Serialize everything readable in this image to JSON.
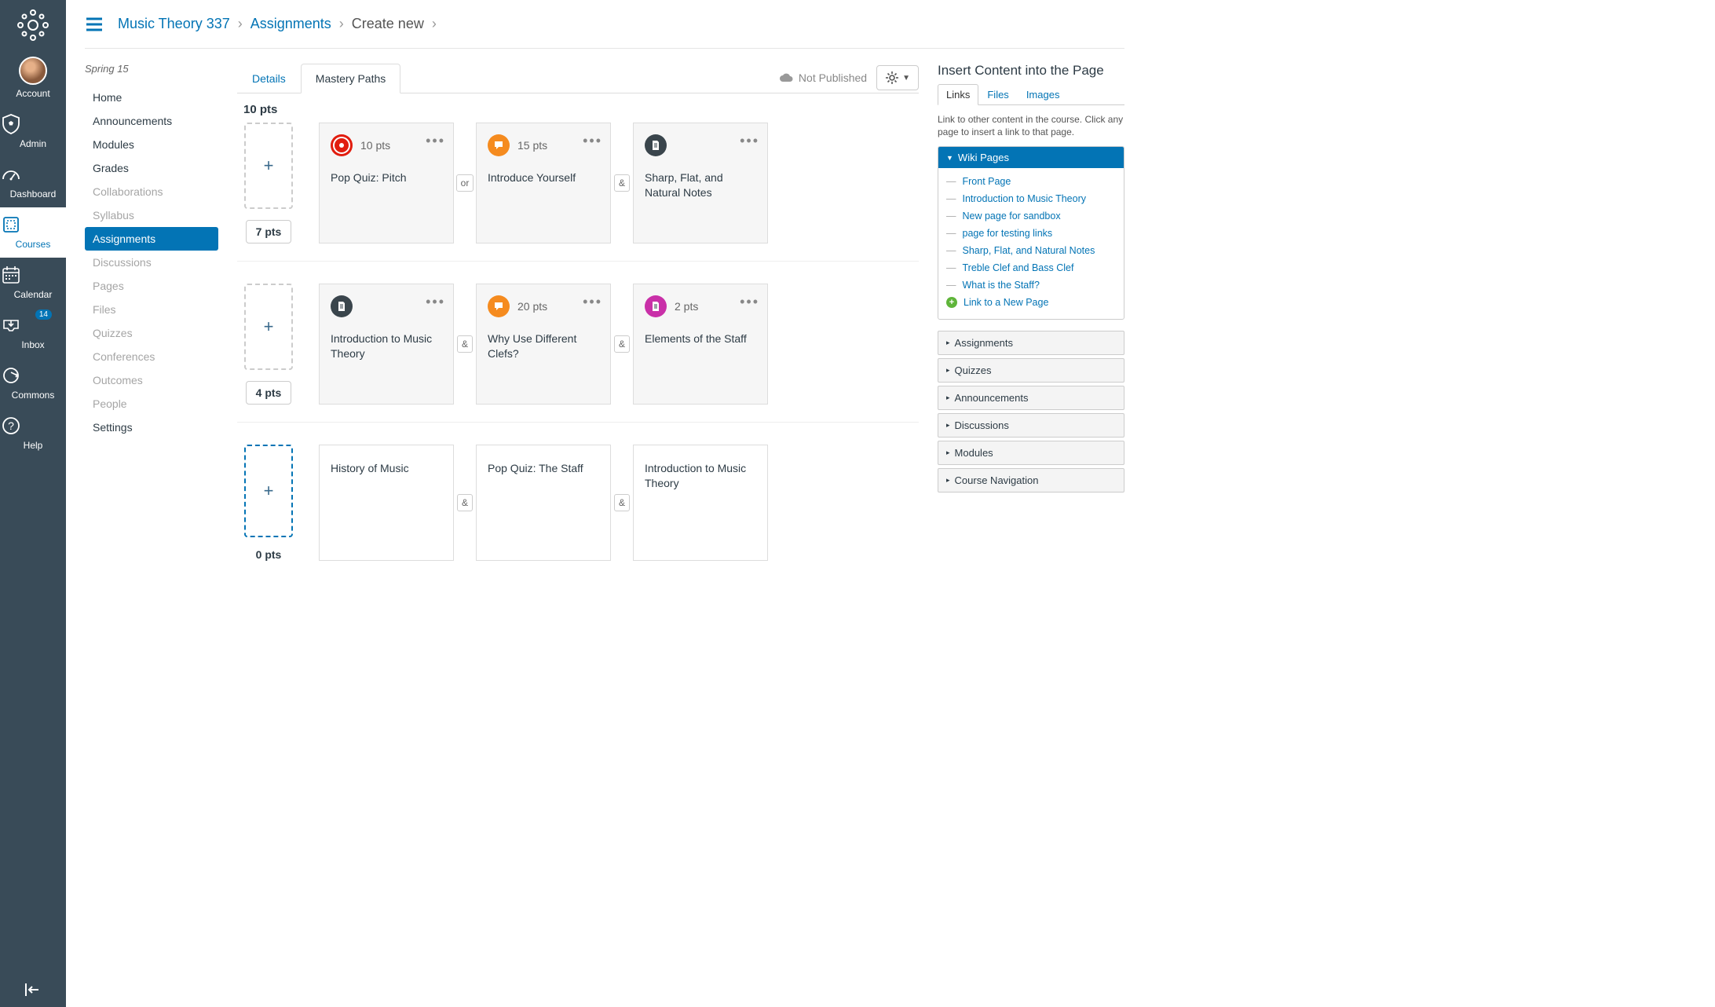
{
  "globalNav": {
    "items": [
      {
        "label": "Account"
      },
      {
        "label": "Admin"
      },
      {
        "label": "Dashboard"
      },
      {
        "label": "Courses"
      },
      {
        "label": "Calendar"
      },
      {
        "label": "Inbox",
        "badge": "14"
      },
      {
        "label": "Commons"
      },
      {
        "label": "Help"
      }
    ]
  },
  "breadcrumbs": {
    "course": "Music Theory 337",
    "section": "Assignments",
    "current": "Create new"
  },
  "courseNav": {
    "term": "Spring 15",
    "items": [
      {
        "label": "Home"
      },
      {
        "label": "Announcements"
      },
      {
        "label": "Modules"
      },
      {
        "label": "Grades"
      },
      {
        "label": "Collaborations",
        "dim": true
      },
      {
        "label": "Syllabus",
        "dim": true
      },
      {
        "label": "Assignments",
        "active": true
      },
      {
        "label": "Discussions",
        "dim": true
      },
      {
        "label": "Pages",
        "dim": true
      },
      {
        "label": "Files",
        "dim": true
      },
      {
        "label": "Quizzes",
        "dim": true
      },
      {
        "label": "Conferences",
        "dim": true
      },
      {
        "label": "Outcomes",
        "dim": true
      },
      {
        "label": "People",
        "dim": true
      },
      {
        "label": "Settings"
      }
    ]
  },
  "tabs": {
    "details": "Details",
    "mastery": "Mastery Paths"
  },
  "publishStatus": "Not Published",
  "topPts": "10 pts",
  "paths": [
    {
      "lowerPts": "7 pts",
      "cards": [
        {
          "icon": "red",
          "iconType": "quiz",
          "pts": "10 pts",
          "title": "Pop Quiz: Pitch",
          "conn": "or"
        },
        {
          "icon": "orange",
          "iconType": "discussion",
          "pts": "15 pts",
          "title": "Introduce Yourself",
          "conn": "&"
        },
        {
          "icon": "dark",
          "iconType": "page",
          "pts": "",
          "title": "Sharp, Flat, and Natural Notes"
        }
      ]
    },
    {
      "lowerPts": "4 pts",
      "cards": [
        {
          "icon": "dark",
          "iconType": "page",
          "pts": "",
          "title": "Introduction to Music Theory",
          "conn": "&"
        },
        {
          "icon": "orange",
          "iconType": "discussion",
          "pts": "20 pts",
          "title": "Why Use Different Clefs?",
          "conn": "&"
        },
        {
          "icon": "pink",
          "iconType": "page",
          "pts": "2 pts",
          "title": "Elements of the Staff"
        }
      ]
    },
    {
      "lowerPts": "0 pts",
      "active": true,
      "cards": [
        {
          "plain": true,
          "title": "History of Music",
          "conn": "&"
        },
        {
          "plain": true,
          "title": "Pop Quiz: The Staff",
          "conn": "&"
        },
        {
          "plain": true,
          "title": "Introduction to Music Theory"
        }
      ]
    }
  ],
  "rightSidebar": {
    "heading": "Insert Content into the Page",
    "tabs": {
      "links": "Links",
      "files": "Files",
      "images": "Images"
    },
    "hint": "Link to other content in the course. Click any page to insert a link to that page.",
    "wikiHeader": "Wiki Pages",
    "wikiPages": [
      "Front Page",
      "Introduction to Music Theory",
      "New page for sandbox",
      "page for testing links",
      "Sharp, Flat, and Natural Notes",
      "Treble Clef and Bass Clef",
      "What is the Staff?"
    ],
    "newPageLink": "Link to a New Page",
    "accordions": [
      "Assignments",
      "Quizzes",
      "Announcements",
      "Discussions",
      "Modules",
      "Course Navigation"
    ]
  }
}
